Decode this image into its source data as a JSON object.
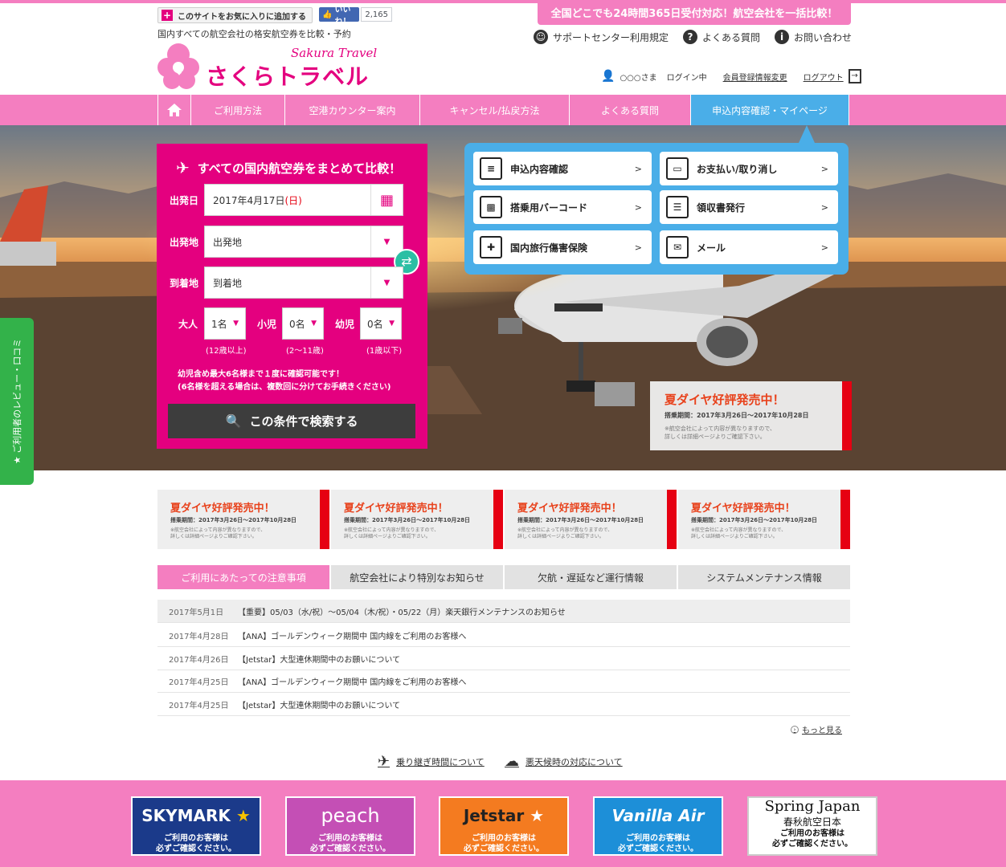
{
  "header": {
    "favorite_button": "このサイトをお気に入りに追加する",
    "like_label": "いいね！",
    "like_count": "2,165",
    "tagline": "国内すべての航空会社の格安航空券を比較・予約",
    "logo_en": "Sakura Travel",
    "logo_jp": "さくらトラベル",
    "banner": "全国どこでも24時間365日受付対応！航空会社を一括比較！",
    "support_links": [
      "サポートセンター利用規定",
      "よくある質問",
      "お問い合わせ"
    ],
    "user_name": "○○○さま",
    "login_status": "ログイン中",
    "member_link": "会員登録情報変更",
    "logout_link": "ログアウト"
  },
  "nav": {
    "items": [
      "ご利用方法",
      "空港カウンター案内",
      "キャンセル/払戻方法",
      "よくある質問",
      "申込内容確認・マイページ"
    ]
  },
  "search": {
    "title": "すべての国内航空券をまとめて比較！",
    "date_label": "出発日",
    "date_value": "2017年4月17日",
    "date_weekday": "(日)",
    "from_label": "出発地",
    "from_value": "出発地",
    "to_label": "到着地",
    "to_value": "到着地",
    "adult_label": "大人",
    "adult_value": "1名",
    "adult_note": "(12歳以上)",
    "child_label": "小児",
    "child_value": "0名",
    "child_note": "(2〜11歳)",
    "infant_label": "幼児",
    "infant_value": "0名",
    "infant_note": "(1歳以下)",
    "note_line1": "幼児含め最大6名様まで１度に確認可能です！",
    "note_line2": "(6名様を超える場合は、複数回に分けてお手続きください)",
    "submit": "この条件で検索する"
  },
  "mypage": {
    "buttons": [
      "申込内容確認",
      "お支払い/取り消し",
      "搭乗用バーコード",
      "領収書発行",
      "国内旅行傷害保険",
      "メール"
    ],
    "chevron": ">"
  },
  "promo": {
    "title": "夏ダイヤ好評発売中！",
    "period": "搭乗期間：2017年3月26日〜2017年10月28日",
    "note_line1": "※航空会社によって内容が異なりますので、",
    "note_line2": "詳しくは詳細ページよりご確認下さい。"
  },
  "review_tab": "★ ご利用者のレビュー・口コミ",
  "info": {
    "tabs": [
      "ご利用にあたっての注意事項",
      "航空会社により特別なお知らせ",
      "欠航・遅延など運行情報",
      "システムメンテナンス情報"
    ],
    "news": [
      {
        "date": "2017年5月1日",
        "text": "【重要】05/03（水/祝）〜05/04（木/祝）・05/22（月）楽天銀行メンテナンスのお知らせ"
      },
      {
        "date": "2017年4月28日",
        "text": "【ANA】ゴールデンウィーク期間中 国内線をご利用のお客様へ"
      },
      {
        "date": "2017年4月26日",
        "text": "【Jetstar】大型連休期間中のお願いについて"
      },
      {
        "date": "2017年4月25日",
        "text": "【ANA】ゴールデンウィーク期間中 国内線をご利用のお客様へ"
      },
      {
        "date": "2017年4月25日",
        "text": "【Jetstar】大型連休期間中のお願いについて"
      }
    ],
    "more": "もっと見る"
  },
  "links": {
    "transfer": "乗り継ぎ時間について",
    "weather": "悪天候時の対応について"
  },
  "airlines": [
    {
      "name": "SKYMARK",
      "sub1": "ご利用のお客様は",
      "sub2": "必ずご確認ください。",
      "bg": "#1b3a8a",
      "fg": "#ffffff"
    },
    {
      "name": "peach",
      "sub1": "ご利用のお客様は",
      "sub2": "必ずご確認ください。",
      "bg": "#c44fb5",
      "fg": "#ffffff"
    },
    {
      "name": "Jetstar",
      "sub1": "ご利用のお客様は",
      "sub2": "必ずご確認ください。",
      "bg": "#f47b20",
      "fg": "#222222"
    },
    {
      "name": "Vanilla Air",
      "sub1": "ご利用のお客様は",
      "sub2": "必ずご確認ください。",
      "bg": "#1d8fd8",
      "fg": "#ffffff"
    },
    {
      "name": "Spring Japan",
      "name2": "春秋航空日本",
      "sub1": "ご利用のお客様は",
      "sub2": "必ずご確認ください。",
      "bg": "#ffffff",
      "fg": "#111111"
    }
  ],
  "colors": {
    "brand_pink": "#f47ec0",
    "search_magenta": "#e4007f",
    "mypage_blue": "#4aaee8",
    "review_green": "#33b24a",
    "promo_red": "#e60012"
  }
}
